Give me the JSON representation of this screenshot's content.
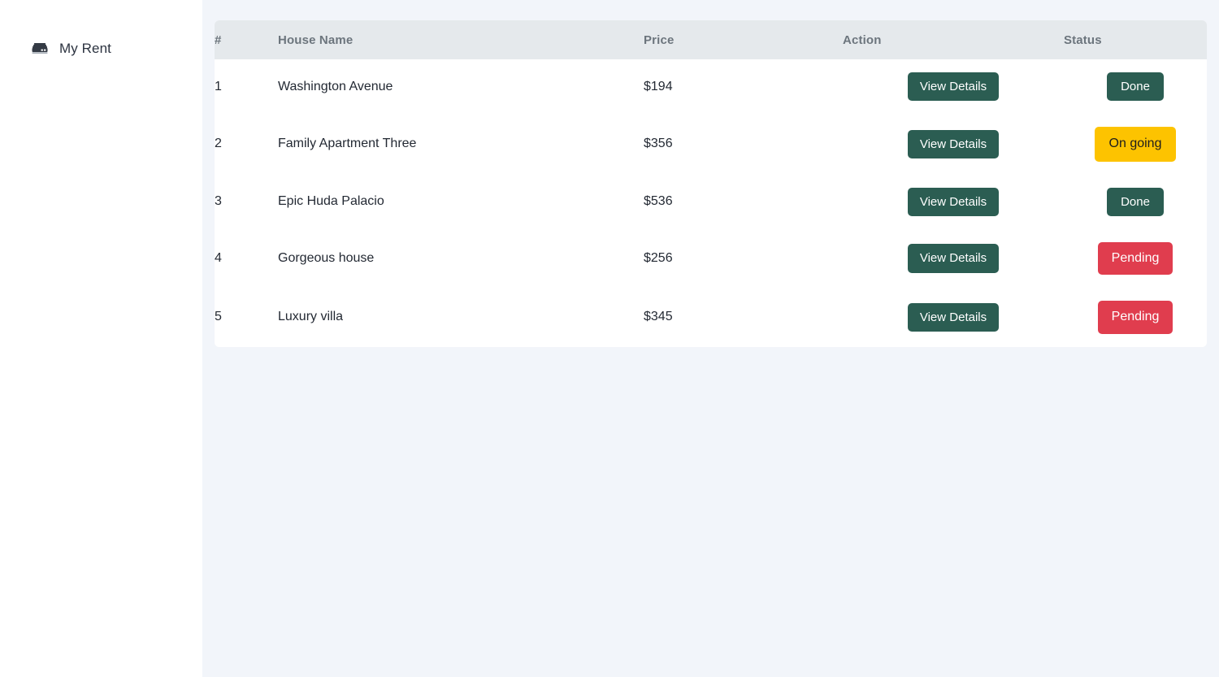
{
  "sidebar": {
    "items": [
      {
        "icon": "bed-icon",
        "label": "My Rent"
      }
    ]
  },
  "table": {
    "columns": {
      "num": "#",
      "name": "House Name",
      "price": "Price",
      "action": "Action",
      "status": "Status"
    },
    "action_label": "View Details",
    "rows": [
      {
        "num": "1",
        "name": "Washington Avenue",
        "price": "$194",
        "action": "View Details",
        "status": "Done",
        "status_type": "done"
      },
      {
        "num": "2",
        "name": "Family Apartment Three",
        "price": "$356",
        "action": "View Details",
        "status": "On going",
        "status_type": "ongoing"
      },
      {
        "num": "3",
        "name": "Epic Huda Palacio",
        "price": "$536",
        "action": "View Details",
        "status": "Done",
        "status_type": "done"
      },
      {
        "num": "4",
        "name": "Gorgeous house",
        "price": "$256",
        "action": "View Details",
        "status": "Pending",
        "status_type": "pending"
      },
      {
        "num": "5",
        "name": "Luxury villa",
        "price": "$345",
        "action": "View Details",
        "status": "Pending",
        "status_type": "pending"
      }
    ]
  },
  "colors": {
    "accent_dark_green": "#2b5d52",
    "status_ongoing": "#fdc300",
    "status_pending": "#e03d4e",
    "header_bg": "#e5e9ec",
    "page_bg": "#f2f5fa"
  }
}
